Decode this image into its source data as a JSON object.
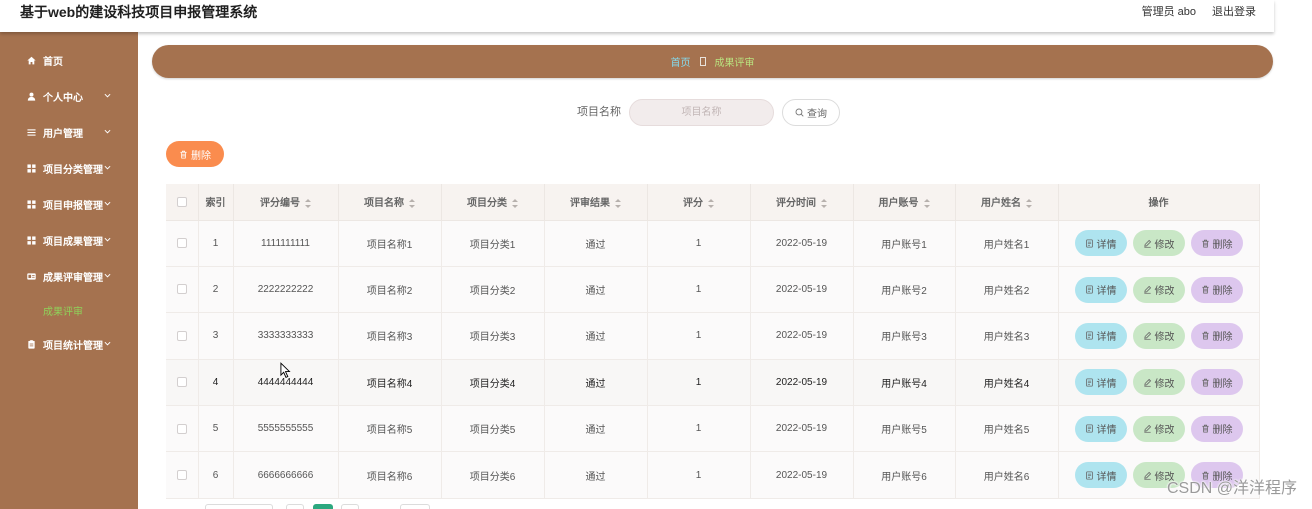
{
  "header": {
    "title": "基于web的建设科技项目申报管理系统",
    "user_label": "管理员 abo",
    "logout_label": "退出登录"
  },
  "sidebar": {
    "items": [
      {
        "label": "首页",
        "icon": "home-icon",
        "expandable": false
      },
      {
        "label": "个人中心",
        "icon": "user-icon",
        "expandable": true
      },
      {
        "label": "用户管理",
        "icon": "list-icon",
        "expandable": true
      },
      {
        "label": "项目分类管理",
        "icon": "grid-icon",
        "expandable": true
      },
      {
        "label": "项目申报管理",
        "icon": "grid-icon",
        "expandable": true
      },
      {
        "label": "项目成果管理",
        "icon": "grid-icon",
        "expandable": true
      },
      {
        "label": "成果评审管理",
        "icon": "card-icon",
        "expandable": true,
        "expanded": true,
        "children": [
          {
            "label": "成果评审",
            "active": true
          }
        ]
      },
      {
        "label": "项目统计管理",
        "icon": "clipboard-icon",
        "expandable": true
      }
    ]
  },
  "breadcrumb": {
    "home": "首页",
    "separator_icon": "box-icon",
    "current": "成果评审"
  },
  "search": {
    "label": "项目名称",
    "placeholder": "项目名称",
    "button_label": "查询",
    "button_icon": "search-icon"
  },
  "toolbar": {
    "delete_label": "删除",
    "delete_icon": "trash-icon"
  },
  "table": {
    "columns": [
      {
        "label": "索引",
        "sortable": false
      },
      {
        "label": "评分编号",
        "sortable": true
      },
      {
        "label": "项目名称",
        "sortable": true
      },
      {
        "label": "项目分类",
        "sortable": true
      },
      {
        "label": "评审结果",
        "sortable": true
      },
      {
        "label": "评分",
        "sortable": true
      },
      {
        "label": "评分时间",
        "sortable": true
      },
      {
        "label": "用户账号",
        "sortable": true
      },
      {
        "label": "用户姓名",
        "sortable": true
      },
      {
        "label": "操作",
        "sortable": false
      }
    ],
    "rows": [
      {
        "index": "1",
        "score_no": "1111111111",
        "project_name": "项目名称1",
        "project_category": "项目分类1",
        "review_result": "通过",
        "score": "1",
        "score_time": "2022-05-19",
        "user_account": "用户账号1",
        "user_name": "用户姓名1"
      },
      {
        "index": "2",
        "score_no": "2222222222",
        "project_name": "项目名称2",
        "project_category": "项目分类2",
        "review_result": "通过",
        "score": "1",
        "score_time": "2022-05-19",
        "user_account": "用户账号2",
        "user_name": "用户姓名2"
      },
      {
        "index": "3",
        "score_no": "3333333333",
        "project_name": "项目名称3",
        "project_category": "项目分类3",
        "review_result": "通过",
        "score": "1",
        "score_time": "2022-05-19",
        "user_account": "用户账号3",
        "user_name": "用户姓名3"
      },
      {
        "index": "4",
        "score_no": "4444444444",
        "project_name": "项目名称4",
        "project_category": "项目分类4",
        "review_result": "通过",
        "score": "1",
        "score_time": "2022-05-19",
        "user_account": "用户账号4",
        "user_name": "用户姓名4",
        "hovered": true
      },
      {
        "index": "5",
        "score_no": "5555555555",
        "project_name": "项目名称5",
        "project_category": "项目分类5",
        "review_result": "通过",
        "score": "1",
        "score_time": "2022-05-19",
        "user_account": "用户账号5",
        "user_name": "用户姓名5"
      },
      {
        "index": "6",
        "score_no": "6666666666",
        "project_name": "项目名称6",
        "project_category": "项目分类6",
        "review_result": "通过",
        "score": "1",
        "score_time": "2022-05-19",
        "user_account": "用户账号6",
        "user_name": "用户姓名6"
      }
    ],
    "row_actions": {
      "detail": "详情",
      "detail_icon": "document-icon",
      "edit": "修改",
      "edit_icon": "pencil-icon",
      "delete": "删除",
      "delete_icon": "trash-icon"
    }
  },
  "watermark": "CSDN @洋洋程序",
  "colors": {
    "sidebar_bg": "#a5724f",
    "breadcrumb_home": "#85dbee",
    "breadcrumb_current": "#b9e27f",
    "active_menu_text": "#8fd25a",
    "delete_button": "#fa8c4e",
    "detail_button": "#aee4ef",
    "edit_button": "#c9e7c6",
    "row_delete_button": "#ddc7ee",
    "active_page": "#2ca87f"
  }
}
